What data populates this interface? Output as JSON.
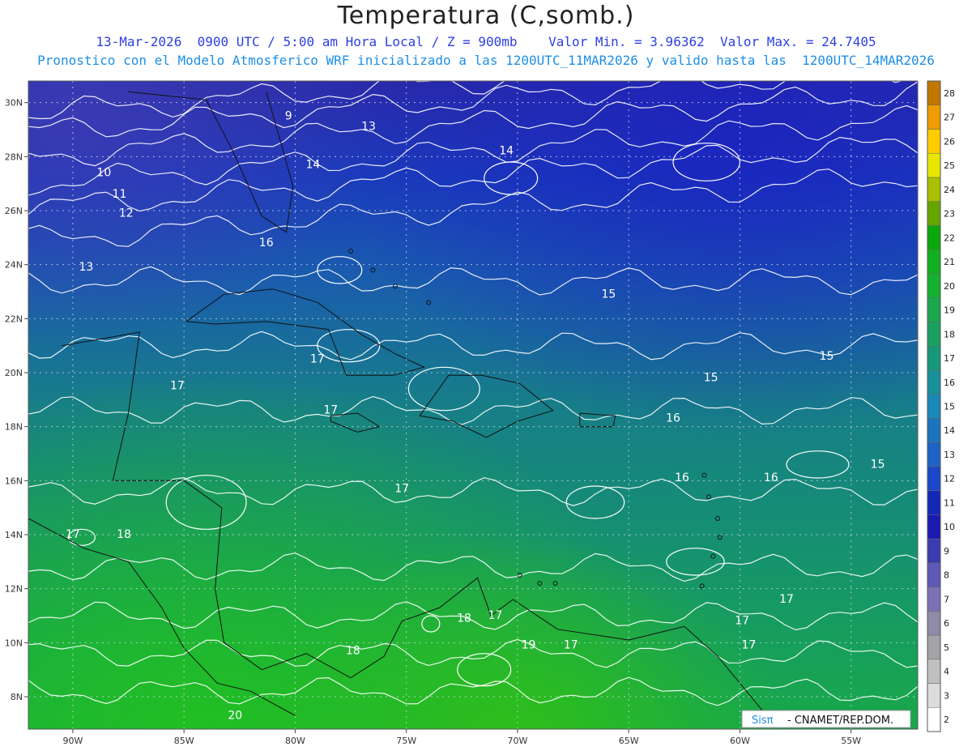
{
  "header": {
    "title": "Temperatura (C,somb.)",
    "line1": "13-Mar-2026  0900 UTC / 5:00 am Hora Local / Z = 900mb    Valor Min. = 3.96362  Valor Max. = 24.7405",
    "line2": "Pronostico con el Modelo Atmosferico WRF inicializado a las 1200UTC_11MAR2026 y valido hasta las  1200UTC_14MAR2026"
  },
  "map": {
    "lon_range": [
      -92,
      -52
    ],
    "lat_range": [
      6.8,
      30.8
    ],
    "lat_ticks": [
      {
        "lat": 30,
        "label": "30N"
      },
      {
        "lat": 28,
        "label": "28N"
      },
      {
        "lat": 26,
        "label": "26N"
      },
      {
        "lat": 24,
        "label": "24N"
      },
      {
        "lat": 22,
        "label": "22N"
      },
      {
        "lat": 20,
        "label": "20N"
      },
      {
        "lat": 18,
        "label": "18N"
      },
      {
        "lat": 16,
        "label": "16N"
      },
      {
        "lat": 14,
        "label": "14N"
      },
      {
        "lat": 12,
        "label": "12N"
      },
      {
        "lat": 10,
        "label": "10N"
      },
      {
        "lat": 8,
        "label": "8N"
      }
    ],
    "lon_ticks": [
      {
        "lon": -90,
        "label": "90W"
      },
      {
        "lon": -85,
        "label": "85W"
      },
      {
        "lon": -80,
        "label": "80W"
      },
      {
        "lon": -75,
        "label": "75W"
      },
      {
        "lon": -70,
        "label": "70W"
      },
      {
        "lon": -65,
        "label": "65W"
      },
      {
        "lon": -60,
        "label": "60W"
      },
      {
        "lon": -55,
        "label": "55W"
      }
    ],
    "contour_labels": [
      {
        "text": "9",
        "lon": -80.3,
        "lat": 29.5
      },
      {
        "text": "13",
        "lon": -76.7,
        "lat": 29.1
      },
      {
        "text": "14",
        "lon": -70.5,
        "lat": 28.2
      },
      {
        "text": "14",
        "lon": -79.2,
        "lat": 27.7
      },
      {
        "text": "10",
        "lon": -88.6,
        "lat": 27.4
      },
      {
        "text": "11",
        "lon": -87.9,
        "lat": 26.6
      },
      {
        "text": "12",
        "lon": -87.6,
        "lat": 25.9
      },
      {
        "text": "16",
        "lon": -81.3,
        "lat": 24.8
      },
      {
        "text": "13",
        "lon": -89.4,
        "lat": 23.9
      },
      {
        "text": "15",
        "lon": -65.9,
        "lat": 22.9
      },
      {
        "text": "17",
        "lon": -79.0,
        "lat": 20.5
      },
      {
        "text": "15",
        "lon": -56.1,
        "lat": 20.6
      },
      {
        "text": "15",
        "lon": -61.3,
        "lat": 19.8
      },
      {
        "text": "17",
        "lon": -85.3,
        "lat": 19.5
      },
      {
        "text": "17",
        "lon": -78.4,
        "lat": 18.6
      },
      {
        "text": "16",
        "lon": -63.0,
        "lat": 18.3
      },
      {
        "text": "15",
        "lon": -53.8,
        "lat": 16.6
      },
      {
        "text": "16",
        "lon": -62.6,
        "lat": 16.1
      },
      {
        "text": "16",
        "lon": -58.6,
        "lat": 16.1
      },
      {
        "text": "17",
        "lon": -75.2,
        "lat": 15.7
      },
      {
        "text": "17",
        "lon": -90.0,
        "lat": 14.0
      },
      {
        "text": "18",
        "lon": -87.7,
        "lat": 14.0
      },
      {
        "text": "18",
        "lon": -72.4,
        "lat": 10.9
      },
      {
        "text": "17",
        "lon": -71.0,
        "lat": 11.0
      },
      {
        "text": "17",
        "lon": -57.9,
        "lat": 11.6
      },
      {
        "text": "17",
        "lon": -59.9,
        "lat": 10.8
      },
      {
        "text": "19",
        "lon": -69.5,
        "lat": 9.9
      },
      {
        "text": "17",
        "lon": -67.6,
        "lat": 9.9
      },
      {
        "text": "17",
        "lon": -59.6,
        "lat": 9.9
      },
      {
        "text": "18",
        "lon": -77.4,
        "lat": 9.7
      },
      {
        "text": "20",
        "lon": -82.7,
        "lat": 7.3
      }
    ]
  },
  "colorbar": {
    "labels": [
      "2",
      "3",
      "4",
      "5",
      "6",
      "7",
      "8",
      "9",
      "10",
      "11",
      "12",
      "13",
      "14",
      "15",
      "16",
      "17",
      "18",
      "19",
      "20",
      "21",
      "22",
      "23",
      "24",
      "25",
      "26",
      "27",
      "28"
    ],
    "colors": [
      "#ffffff",
      "#dcdcdc",
      "#c0c0c0",
      "#a4a4a8",
      "#8e8aa8",
      "#7a72b4",
      "#5e58b6",
      "#3c3cb0",
      "#1a1ab2",
      "#1428b8",
      "#1a48c8",
      "#1e62c6",
      "#1c74be",
      "#1a88b8",
      "#18909a",
      "#169878",
      "#1aa062",
      "#1aa84e",
      "#16b030",
      "#10b020",
      "#0aa80c",
      "#66a400",
      "#a8c000",
      "#e6e600",
      "#ffcc00",
      "#ee9c00",
      "#c07800"
    ]
  },
  "credit": {
    "brand": "Sisπ",
    "org": "- CNAMET/REP.DOM."
  }
}
